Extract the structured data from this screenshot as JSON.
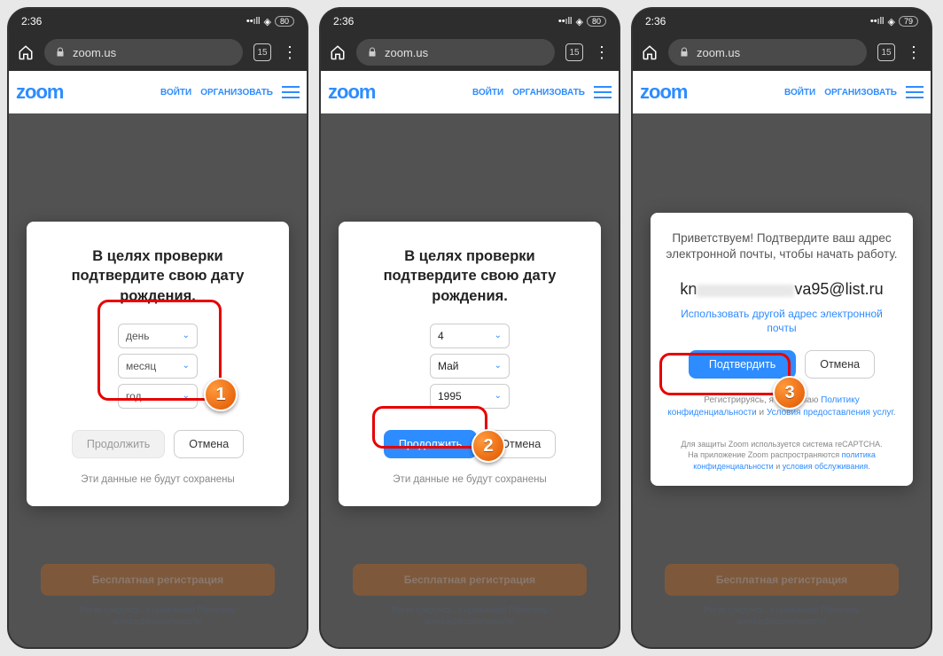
{
  "status": {
    "time": "2:36",
    "signal": "••ıll",
    "wifi": "⊚",
    "battery1": "80",
    "battery3": "79"
  },
  "browser": {
    "url": "zoom.us",
    "tabs": "15"
  },
  "zoomNav": {
    "login": "ВОЙТИ",
    "organize": "ОРГАНИЗОВАТЬ"
  },
  "logo": "zoom",
  "modal1": {
    "title": "В целях проверки подтвердите свою дату рождения.",
    "day": "день",
    "month": "месяц",
    "year": "год",
    "continue": "Продолжить",
    "cancel": "Отмена",
    "footnote": "Эти данные не будут сохранены"
  },
  "modal2": {
    "title": "В целях проверки подтвердите свою дату рождения.",
    "day": "4",
    "month": "Май",
    "year": "1995",
    "continue": "Продолжить",
    "cancel": "Отмена",
    "footnote": "Эти данные не будут сохранены"
  },
  "modal3": {
    "title": "Приветствуем! Подтвердите ваш адрес электронной почты, чтобы начать работу.",
    "emailPrefix": "kn",
    "emailSuffix": "va95@list.ru",
    "otherEmail": "Использовать другой адрес электронной почты",
    "confirm": "Подтвердить",
    "cancel": "Отмена",
    "agreePrefix": "Регистрируясь, я принимаю ",
    "privacy": "Политику конфиденциальности",
    "and": " и ",
    "terms": "Условия предоставления услуг",
    "captchaLine1": "Для защиты Zoom используется система reCAPTCHA.",
    "captchaLine2a": "На приложение Zoom распространяются ",
    "captchaPriv": "политика конфиденциальности",
    "captchaAnd": " и ",
    "captchaTerms": "условия обслуживания",
    "period": "."
  },
  "bg": {
    "register": "Бесплатная регистрация",
    "policy1": "Регистрируясь, я принимаю Политику",
    "policy2": "конфиденциальности"
  },
  "steps": {
    "s1": "1",
    "s2": "2",
    "s3": "3"
  }
}
